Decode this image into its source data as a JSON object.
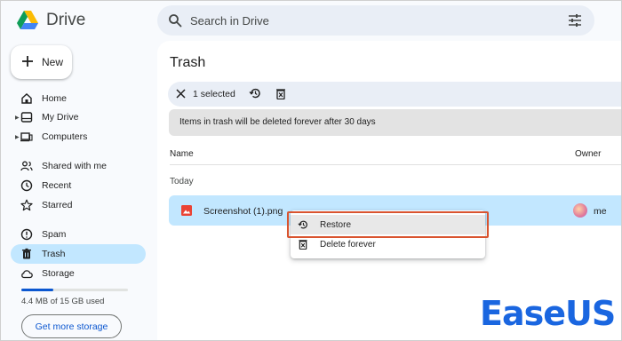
{
  "app": {
    "name": "Drive"
  },
  "search": {
    "placeholder": "Search in Drive"
  },
  "sidebar": {
    "new_label": "New",
    "items": [
      {
        "label": "Home",
        "icon": "home-icon"
      },
      {
        "label": "My Drive",
        "icon": "my-drive-icon",
        "expandable": true
      },
      {
        "label": "Computers",
        "icon": "computers-icon",
        "expandable": true
      },
      {
        "label": "Shared with me",
        "icon": "people-icon"
      },
      {
        "label": "Recent",
        "icon": "clock-icon"
      },
      {
        "label": "Starred",
        "icon": "star-icon"
      },
      {
        "label": "Spam",
        "icon": "spam-icon"
      },
      {
        "label": "Trash",
        "icon": "trash-icon",
        "active": true
      },
      {
        "label": "Storage",
        "icon": "cloud-icon"
      }
    ],
    "storage_used_text": "4.4 MB of 15 GB used",
    "storage_button": "Get more storage"
  },
  "main": {
    "title": "Trash",
    "selection": {
      "count_text": "1 selected"
    },
    "notice": "Items in trash will be deleted forever after 30 days",
    "columns": {
      "name": "Name",
      "owner": "Owner"
    },
    "group": "Today",
    "file": {
      "name": "Screenshot (1).png",
      "owner": "me",
      "selected": true
    }
  },
  "context_menu": {
    "items": [
      {
        "label": "Restore",
        "icon": "restore-icon",
        "hovered": true
      },
      {
        "label": "Delete forever",
        "icon": "delete-forever-icon"
      }
    ]
  },
  "watermark": {
    "text": "EaseUS"
  },
  "colors": {
    "accent": "#0b57d0",
    "active_nav": "#c2e7ff",
    "selected_row": "#c2e7ff",
    "highlight_border": "#d9542f",
    "watermark": "#1a66e0"
  }
}
